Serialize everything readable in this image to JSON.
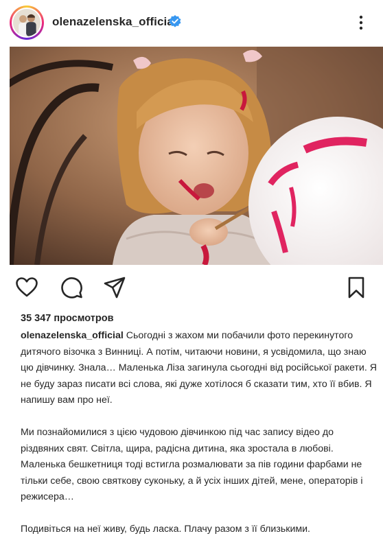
{
  "post": {
    "username": "olenazelenska_official",
    "verified": true,
    "views": "35 347 просмотров",
    "caption_user": "olenazelenska_official",
    "paragraphs": [
      " Сьогодні з жахом ми побачили фото перекинутого дитячого візочка з Винниці. А потім, читаючи новини, я усвідомила, що знаю цю дівчинку. Знала… Маленька Ліза загинула сьогодні від російської ракети. Я не буду зараз писати всі слова, які дуже хотілося б сказати тим, хто її вбив. Я напишу вам про неї.",
      "Ми познайомилися з цією чудовою дівчинкою під час запису відео до різдвяних свят. Світла, щира, радісна дитина, яка зростала в любові. Маленька бешкетниця тоді встигла розмалювати за пів години фарбами не тільки себе, свою святкову суконьку, а й усіх інших дітей, мене, операторів і режисера…",
      "Подивіться на неї живу, будь ласка. Плачу разом з її близькими."
    ]
  },
  "icons": {
    "verified": "verified-badge-icon",
    "more": "more-options-icon",
    "like": "heart-icon",
    "comment": "comment-bubble-icon",
    "share": "paper-plane-icon",
    "save": "bookmark-icon"
  },
  "colors": {
    "verified": "#3897f0",
    "text": "#262626"
  }
}
